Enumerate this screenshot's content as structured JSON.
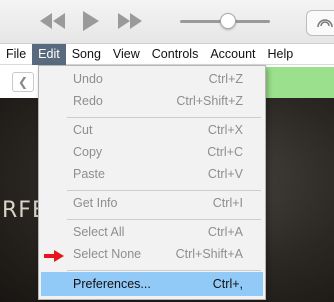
{
  "menubar": {
    "items": [
      {
        "label": "File"
      },
      {
        "label": "Edit"
      },
      {
        "label": "Song"
      },
      {
        "label": "View"
      },
      {
        "label": "Controls"
      },
      {
        "label": "Account"
      },
      {
        "label": "Help"
      }
    ],
    "active_label": "Edit"
  },
  "edit_menu": {
    "undo": {
      "label": "Undo",
      "shortcut": "Ctrl+Z"
    },
    "redo": {
      "label": "Redo",
      "shortcut": "Ctrl+Shift+Z"
    },
    "cut": {
      "label": "Cut",
      "shortcut": "Ctrl+X"
    },
    "copy": {
      "label": "Copy",
      "shortcut": "Ctrl+C"
    },
    "paste": {
      "label": "Paste",
      "shortcut": "Ctrl+V"
    },
    "get_info": {
      "label": "Get Info",
      "shortcut": "Ctrl+I"
    },
    "select_all": {
      "label": "Select All",
      "shortcut": "Ctrl+A"
    },
    "select_none": {
      "label": "Select None",
      "shortcut": "Ctrl+Shift+A"
    },
    "preferences": {
      "label": "Preferences...",
      "shortcut": "Ctrl+,"
    }
  },
  "background": {
    "art_text": "RFEC"
  },
  "colors": {
    "menu_highlight": "#91c9f7",
    "active_menu": "#5a6a7e",
    "pointer_arrow": "#e8141b",
    "green_banner": "#9be08c"
  },
  "toolbar": {
    "icons": [
      "rewind-icon",
      "play-icon",
      "fast-forward-icon",
      "volume-slider",
      "airplay-icon"
    ]
  }
}
